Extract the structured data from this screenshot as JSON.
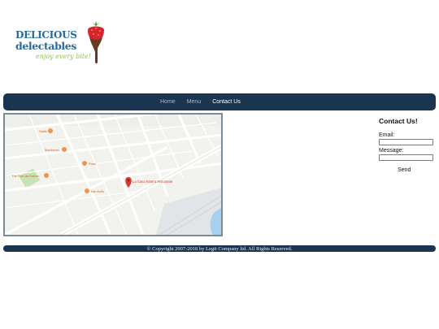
{
  "brand": {
    "line1": "DELICIOUS",
    "line2": "delectables",
    "tagline": "enjoy every bite!",
    "blue": "#2a6a9a",
    "green": "#8cc63f"
  },
  "nav": {
    "items": [
      {
        "label": "Home",
        "active": false
      },
      {
        "label": "Menu",
        "active": false
      },
      {
        "label": "Contact Us",
        "active": true
      }
    ],
    "background": "#1a3550"
  },
  "map": {
    "places": [
      {
        "label": "Hattie",
        "icon": "orange-place-pin-icon"
      },
      {
        "label": "Mardiman",
        "icon": "orange-place-pin-icon"
      },
      {
        "label": "Rask",
        "icon": "orange-place-pin-icon"
      },
      {
        "label": "The Rue du Gallion",
        "icon": "orange-place-pin-icon"
      },
      {
        "label": "Bar Aslla",
        "icon": "orange-place-pin-icon"
      }
    ],
    "marker": {
      "label": "La Casa Nostra Ristorante",
      "icon": "red-map-marker-icon"
    }
  },
  "contact": {
    "title": "Contact Us!",
    "email_label": "Email:",
    "email_value": "",
    "message_label": "Message:",
    "message_value": "",
    "send_label": "Send"
  },
  "footer": {
    "copyright": "© Copyright 2007-2018 by Legit Company ltd. All Rights Reserved."
  }
}
